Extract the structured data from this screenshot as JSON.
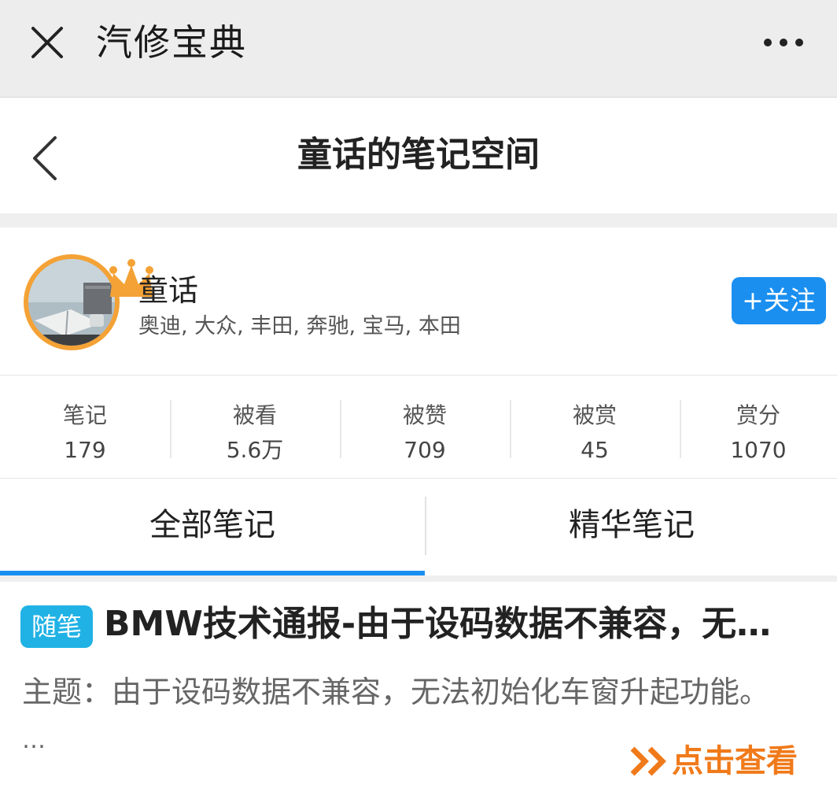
{
  "top_bar": {
    "app_title": "汽修宝典",
    "close_icon": "close-icon",
    "more_icon": "more-dots-icon"
  },
  "nav": {
    "title": "童话的笔记空间",
    "back_icon": "back-chevron-icon"
  },
  "profile": {
    "name": "童话",
    "tags": "奥迪, 大众, 丰田, 奔驰, 宝马, 本田",
    "follow_label": "+关注",
    "badge_icon": "crown-icon"
  },
  "stats": [
    {
      "label": "笔记",
      "value": "179"
    },
    {
      "label": "被看",
      "value": "5.6万"
    },
    {
      "label": "被赞",
      "value": "709"
    },
    {
      "label": "被赏",
      "value": "45"
    },
    {
      "label": "赏分",
      "value": "1070"
    }
  ],
  "tabs": [
    {
      "label": "全部笔记",
      "active": true
    },
    {
      "label": "精华笔记",
      "active": false
    }
  ],
  "note": {
    "tag": "随笔",
    "title": "BMW技术通报-由于设码数据不兼容，无…",
    "summary": "主题：由于设码数据不兼容，无法初始化车窗升起功能。",
    "ellipsis": "…",
    "view_label": "点击查看"
  },
  "colors": {
    "accent_blue": "#1a8ff0",
    "tag_cyan": "#21b2e5",
    "link_orange": "#f07a1a",
    "crown_orange": "#f4a236"
  }
}
